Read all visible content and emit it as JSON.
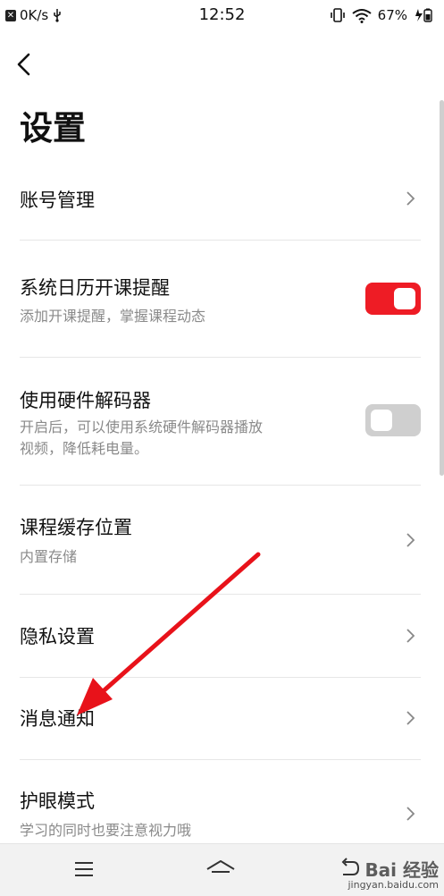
{
  "status_bar": {
    "speed": "0K/s",
    "time": "12:52",
    "battery": "67%"
  },
  "page": {
    "title": "设置"
  },
  "settings": {
    "account": {
      "title": "账号管理"
    },
    "calendar": {
      "title": "系统日历开课提醒",
      "subtitle": "添加开课提醒，掌握课程动态",
      "enabled": true
    },
    "decoder": {
      "title": "使用硬件解码器",
      "subtitle_line1": "开启后，可以使用系统硬件解码器播放",
      "subtitle_line2": "视频，降低耗电量。",
      "enabled": false
    },
    "cache": {
      "title": "课程缓存位置",
      "subtitle": "内置存储"
    },
    "privacy": {
      "title": "隐私设置"
    },
    "notifications": {
      "title": "消息通知"
    },
    "eye_care": {
      "title": "护眼模式",
      "subtitle": "学习的同时也要注意视力哦"
    }
  },
  "colors": {
    "toggle_on": "#ee1c25",
    "toggle_off": "#cfcfcf",
    "annotation_arrow": "#e8121a"
  },
  "icons": {
    "back": "chevron-left-icon",
    "row_chevron": "chevron-right-icon",
    "nav_menu": "menu-icon",
    "nav_home": "home-icon",
    "nav_back": "back-icon"
  },
  "watermark": {
    "brand": "Bai 经验",
    "url": "jingyan.baidu.com"
  }
}
